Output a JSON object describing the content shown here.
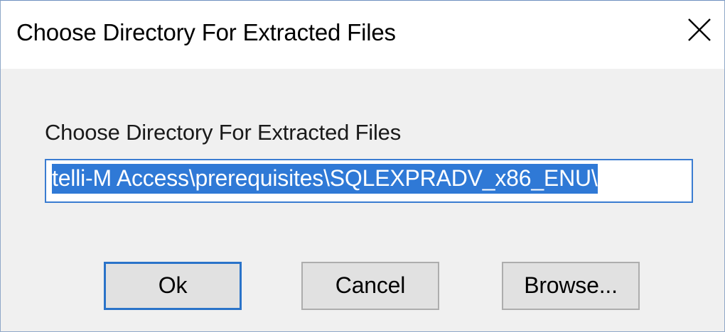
{
  "window": {
    "title": "Choose Directory For Extracted Files",
    "close_icon": "close-icon"
  },
  "form": {
    "label": "Choose Directory For Extracted Files",
    "path_value": "telli-M Access\\prerequisites\\SQLEXPRADV_x86_ENU\\",
    "path_selected": true
  },
  "buttons": {
    "ok_label": "Ok",
    "cancel_label": "Cancel",
    "browse_label": "Browse..."
  },
  "colors": {
    "accent": "#2f79d6",
    "focus_border": "#2a73c9",
    "dialog_bg": "#f0f0f0",
    "button_bg": "#e1e1e1"
  }
}
